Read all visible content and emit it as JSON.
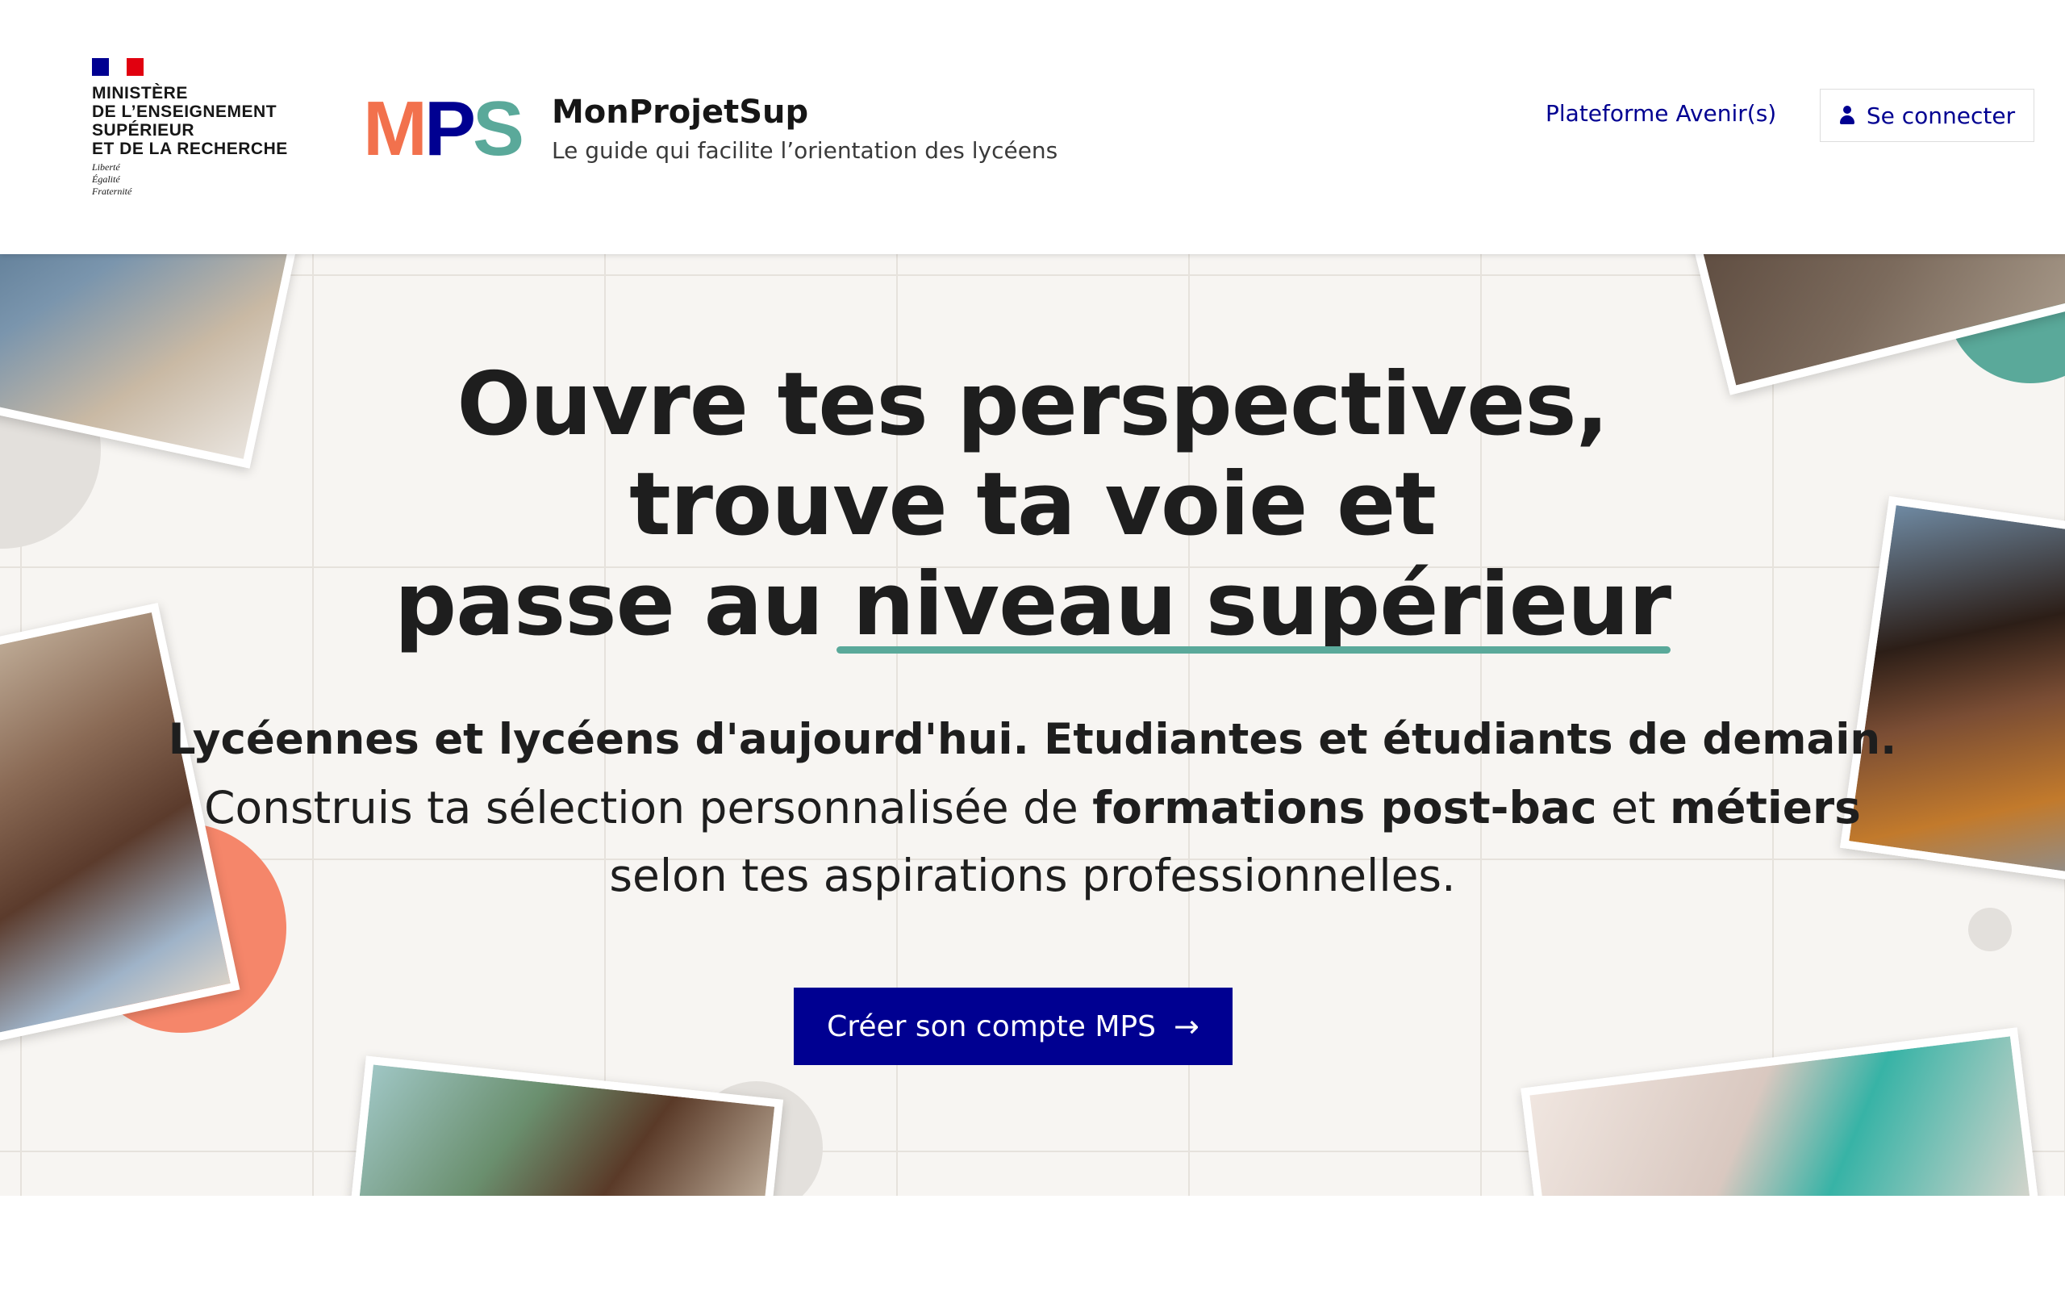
{
  "header": {
    "ministry_lines": [
      "Ministère",
      "de l’enseignement",
      "supérieur",
      "et de la recherche"
    ],
    "motto_lines": [
      "Liberté",
      "Égalité",
      "Fraternité"
    ],
    "logo_letters": {
      "m": "M",
      "p": "P",
      "s": "S"
    },
    "site_name": "MonProjetSup",
    "tagline": "Le guide qui facilite l’orientation des lycéens",
    "nav_link": "Plateforme Avenir(s)",
    "login_label": "Se connecter"
  },
  "hero": {
    "headline_line1": "Ouvre tes perspectives,",
    "headline_line2": "trouve ta voie et",
    "headline_line3_start": "passe au ",
    "headline_line3_highlight": "niveau supérieur",
    "subtitle_line1": "Lycéennes et lycéens d'aujourd'hui. Etudiantes et étudiants de demain.",
    "subtitle_line2_a": "Construis ta sélection personnalisée de ",
    "subtitle_line2_b": "formations post-bac",
    "subtitle_line2_c": " et ",
    "subtitle_line2_d": "métiers",
    "subtitle_line3": "selon tes aspirations professionnelles.",
    "cta_label": "Créer son compte MPS",
    "cta_icon": "arrow-right-icon"
  },
  "colors": {
    "brand_blue": "#000091",
    "accent_green": "#5aa99a",
    "accent_orange": "#f2714d",
    "hero_bg": "#f7f5f2"
  }
}
